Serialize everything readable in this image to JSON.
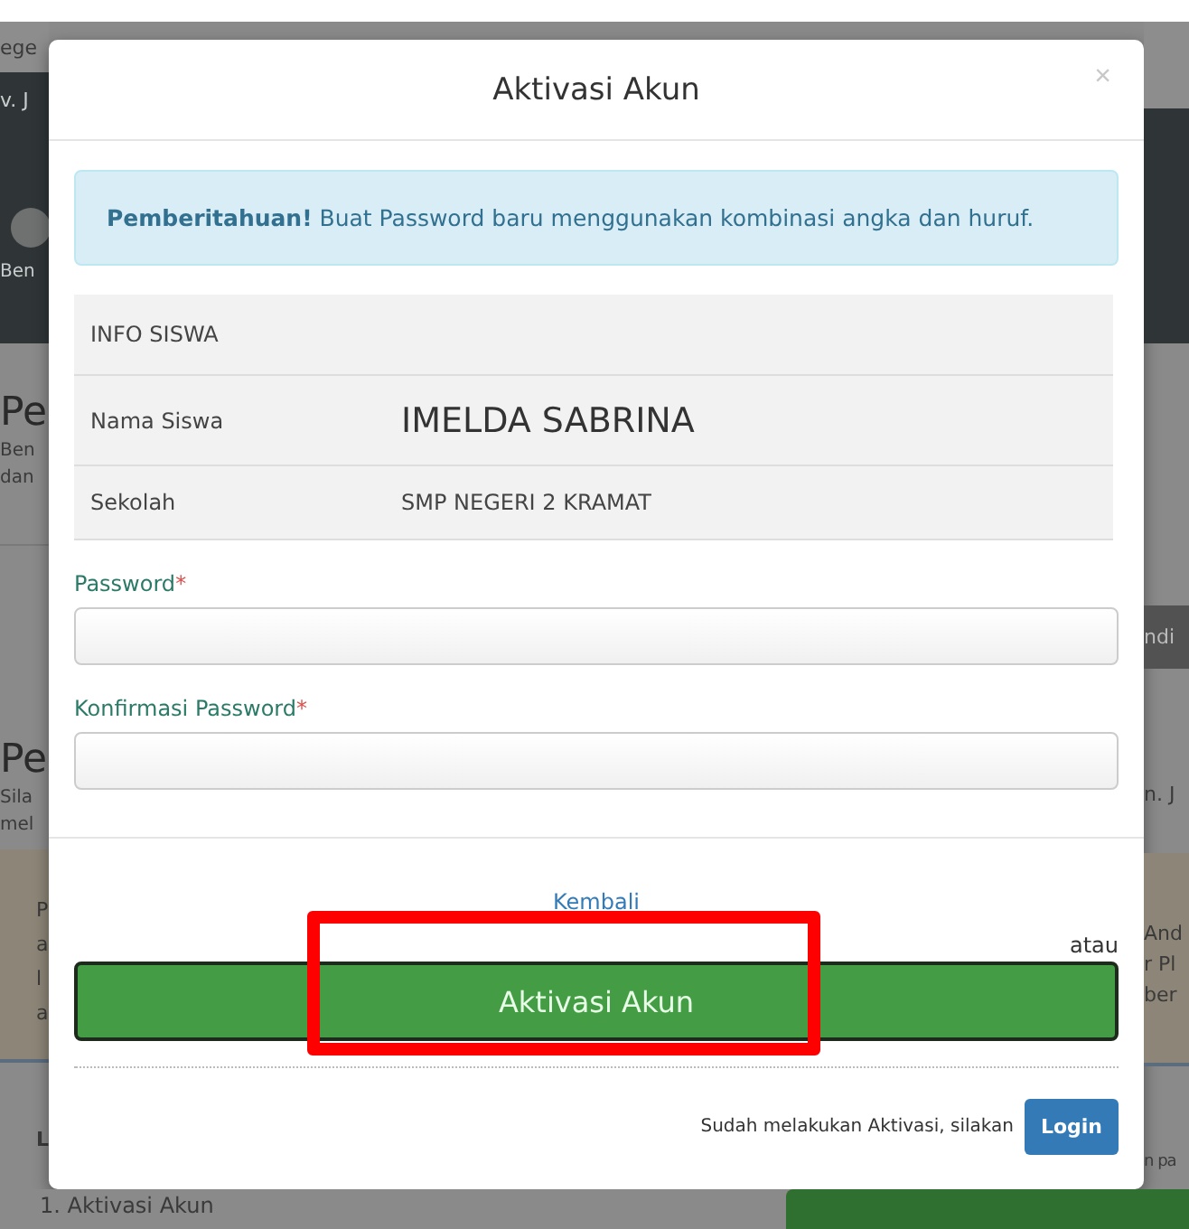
{
  "background_page": {
    "left": {
      "navbar_text": "ege",
      "banner_lines": [
        "v. J",
        "Ben"
      ],
      "section_one": {
        "heading": "Pe",
        "lines": [
          "Ben",
          "dan"
        ]
      },
      "section_two": {
        "heading": "Pe",
        "lines": [
          "Sila",
          "mel"
        ]
      },
      "notice_lines": [
        "P",
        "a",
        "l",
        "a"
      ],
      "list_heading": "L"
    },
    "right": {
      "banner_button": "ndi",
      "line": "n. J",
      "notice_lines": [
        "And",
        "r Pl",
        "ber"
      ],
      "text": "n pa"
    },
    "bottom_text": "1. Aktivasi Akun"
  },
  "modal": {
    "title": "Aktivasi Akun",
    "close": "×",
    "notice": "**Pemberitahuan!** Buat Password baru menggunakan kombinasi angka dan huruf.",
    "info_table": {
      "heading": "INFO SISWA",
      "rows": [
        {
          "label": "Nama Siswa",
          "value": "IMELDA SABRINA",
          "kind": "name"
        },
        {
          "label": "Sekolah",
          "value": "SMP NEGERI 2 KRAMAT",
          "kind": "plain"
        }
      ]
    },
    "fields": [
      {
        "label": "Password",
        "required_mark": "*"
      },
      {
        "label": "Konfirmasi Password",
        "required_mark": "*"
      }
    ],
    "back_link": "Kembali",
    "or_text": "atau",
    "activate_button": "Aktivasi Akun",
    "footer_text": "Sudah melakukan Aktivasi, silakan",
    "login_button": "Login"
  },
  "annotation": {
    "kind": "highlight-box"
  }
}
